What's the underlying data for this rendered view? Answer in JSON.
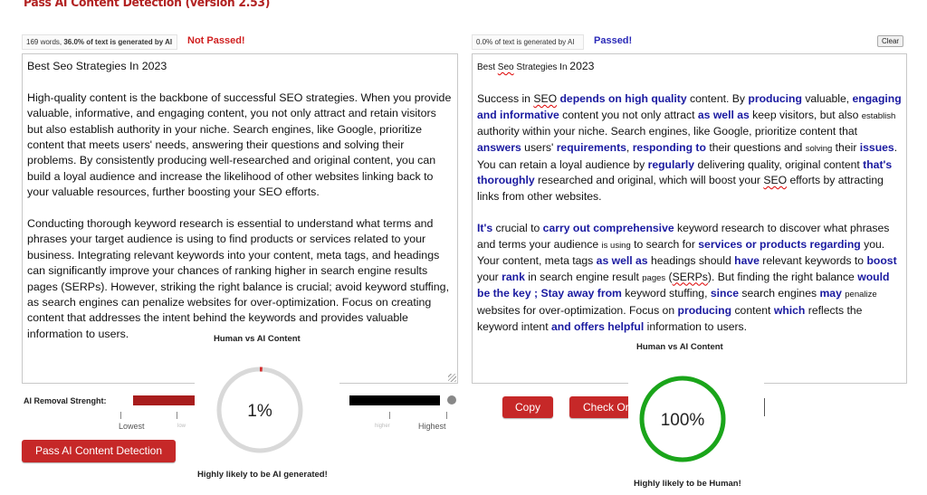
{
  "app": {
    "title": "Pass AI Content Detection (version 2.53)"
  },
  "input_panel": {
    "stats_prefix": "169 words, ",
    "stats_percent": "36.0% of text is generated by AI",
    "status": "Not Passed!",
    "title": "Best Seo Strategies In 2023",
    "paragraphs": [
      "High-quality content is the backbone of successful SEO strategies. When you provide valuable, informative, and engaging content, you not only attract and retain visitors but also establish authority in your niche. Search engines, like Google, prioritize content that meets users' needs, answering their questions and solving their problems. By consistently producing well-researched and original content, you can build a loyal audience and increase the likelihood of other websites linking back to your valuable resources, further boosting your SEO efforts.",
      "Conducting thorough keyword research is essential to understand what terms and phrases your target audience is using to find products or services related to your business. Integrating relevant keywords into your content, meta tags, and headings can significantly improve your chances of ranking higher in search engine results pages (SERPs). However, striking the right balance is crucial; avoid keyword stuffing, as search engines can penalize websites for over-optimization. Focus on creating content that addresses the intent behind the keywords and provides valuable information to users."
    ]
  },
  "output_panel": {
    "stats": "0.0% of text is generated by AI",
    "status": "Passed!",
    "clear_label": "Clear",
    "title": "Best Seo Strategies In 2023"
  },
  "slider": {
    "label": "AI Removal Strenght:",
    "low_label": "Lowest",
    "high_label": "Highest",
    "faint_low": "low",
    "faint_high": "higher",
    "colors": {
      "low_track": "#a81d1d",
      "high_track": "#000000"
    }
  },
  "buttons": {
    "pass": "Pass AI Content Detection",
    "copy": "Copy",
    "check": "Check Origi"
  },
  "gauge_left": {
    "title": "Human vs AI Content",
    "value_text": "1%",
    "value": 0.01,
    "caption": "Highly likely to be AI generated!",
    "color": "#d32f2f"
  },
  "gauge_right": {
    "title": "Human vs AI Content",
    "value_text": "100%",
    "value": 1.0,
    "caption": "Highly likely to be Human!",
    "color": "#1aa51a"
  }
}
